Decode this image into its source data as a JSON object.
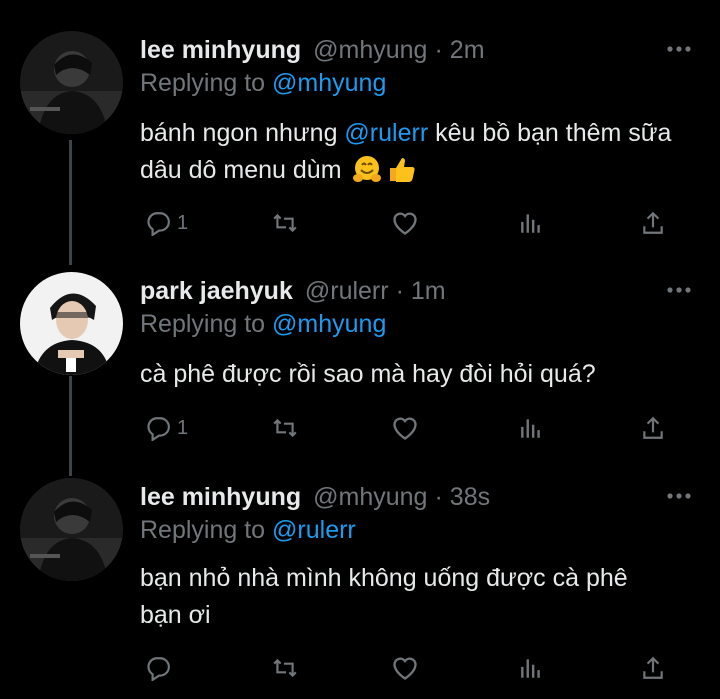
{
  "tweets": [
    {
      "name": "lee minhyung",
      "handle": "@mhyung",
      "separator": "·",
      "time": "2m",
      "replying_prefix": "Replying to ",
      "replying_to": "@mhyung",
      "text_part1": "bánh ngon nhưng ",
      "text_mention": "@rulerr",
      "text_part2": " kêu bồ bạn thêm sữa dâu dô menu dùm",
      "emojis": [
        "hugging-face-emoji",
        "thumbs-up-emoji"
      ],
      "reply_count": "1"
    },
    {
      "name": "park jaehyuk",
      "handle": "@rulerr",
      "separator": "·",
      "time": "1m",
      "replying_prefix": "Replying to ",
      "replying_to": "@mhyung",
      "text": "cà phê được rồi sao mà hay đòi hỏi quá?",
      "reply_count": "1"
    },
    {
      "name": "lee minhyung",
      "handle": "@mhyung",
      "separator": "·",
      "time": "38s",
      "replying_prefix": "Replying to ",
      "replying_to": "@rulerr",
      "text": "bạn nhỏ nhà mình không uống được cà phê bạn ơi",
      "reply_count": ""
    }
  ],
  "icons": {
    "reply": "reply-icon",
    "retweet": "retweet-icon",
    "like": "heart-icon",
    "analytics": "analytics-icon",
    "share": "share-icon",
    "more": "more-icon"
  },
  "colors": {
    "background": "#000000",
    "text": "#e7e9ea",
    "muted": "#71767b",
    "accent": "#1d9bf0",
    "thread_line": "#3d4348"
  }
}
